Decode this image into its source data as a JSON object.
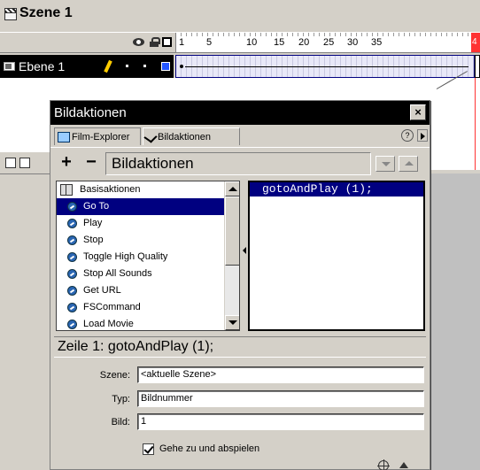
{
  "scene": {
    "title": "Szene 1"
  },
  "timeline": {
    "ruler_labels": [
      "1",
      "5",
      "10",
      "15",
      "20",
      "25",
      "30",
      "35"
    ],
    "playhead_label": "4",
    "layer_name": "Ebene 1"
  },
  "panel": {
    "title": "Bildaktionen",
    "close_label": "×",
    "tabs": [
      {
        "label": "Film-Explorer"
      },
      {
        "label": "Bildaktionen"
      }
    ],
    "help_label": "?",
    "toolbar": {
      "add_label": "+",
      "remove_label": "−",
      "heading": "Bildaktionen"
    },
    "tree": {
      "root": "Basisaktionen",
      "items": [
        "Go To",
        "Play",
        "Stop",
        "Toggle High Quality",
        "Stop All Sounds",
        "Get URL",
        "FSCommand",
        "Load Movie"
      ],
      "selected": "Go To"
    },
    "code_lines": [
      "gotoAndPlay (1);"
    ],
    "status": "Zeile 1: gotoAndPlay (1);",
    "form": {
      "scene_label": "Szene:",
      "scene_value": "<aktuelle Szene>",
      "type_label": "Typ:",
      "type_value": "Bildnummer",
      "frame_label": "Bild:",
      "frame_value": "1",
      "checkbox_label": "Gehe zu und abspielen",
      "checkbox_checked": true
    }
  },
  "colors": {
    "selection": "#000080",
    "titlebar": "#000000",
    "panel_bg": "#d4d0c8",
    "playhead": "#ff3333"
  }
}
